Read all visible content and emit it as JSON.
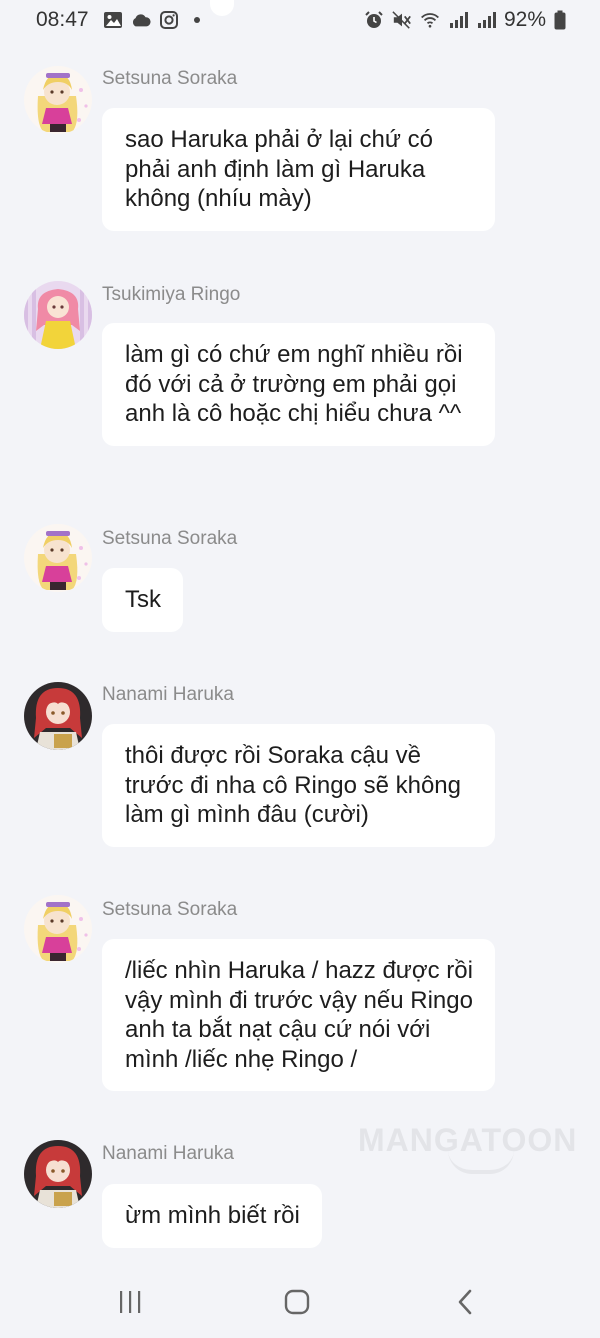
{
  "status_bar": {
    "time": "08:47",
    "battery_percent": "92%",
    "left_icons": [
      "gallery-icon",
      "cloud-icon",
      "instagram-icon",
      "dot-icon"
    ],
    "right_icons": [
      "alarm-icon",
      "mute-icon",
      "wifi-icon",
      "signal-icon",
      "signal-icon",
      "battery-icon"
    ]
  },
  "messages": [
    {
      "sender": "Setsuna Soraka",
      "avatar": "setsuna-avatar",
      "text": "sao Haruka phải ở lại chứ có phải anh định làm gì Haruka không (nhíu mày)"
    },
    {
      "sender": "Tsukimiya Ringo",
      "avatar": "ringo-avatar",
      "text": "làm gì có chứ em nghĩ nhiều rồi đó với cả ở trường em phải gọi anh là cô hoặc chị hiểu chưa ^^"
    },
    {
      "sender": "Setsuna Soraka",
      "avatar": "setsuna-avatar",
      "text": "Tsk"
    },
    {
      "sender": "Nanami Haruka",
      "avatar": "haruka-avatar",
      "text": "thôi được rồi Soraka cậu về trước đi nha cô Ringo sẽ không làm gì mình đâu (cười)"
    },
    {
      "sender": "Setsuna Soraka",
      "avatar": "setsuna-avatar",
      "text": "/liếc nhìn Haruka / hazz được rồi vậy mình đi trước vậy nếu Ringo anh ta bắt nạt cậu cứ nói với mình /liếc nhẹ Ringo /"
    },
    {
      "sender": "Nanami Haruka",
      "avatar": "haruka-avatar",
      "text": "ừm mình biết rồi"
    }
  ],
  "watermark": "MANGATOON",
  "nav_bar": {
    "buttons": [
      "recent-apps-icon",
      "home-icon",
      "back-icon"
    ]
  }
}
